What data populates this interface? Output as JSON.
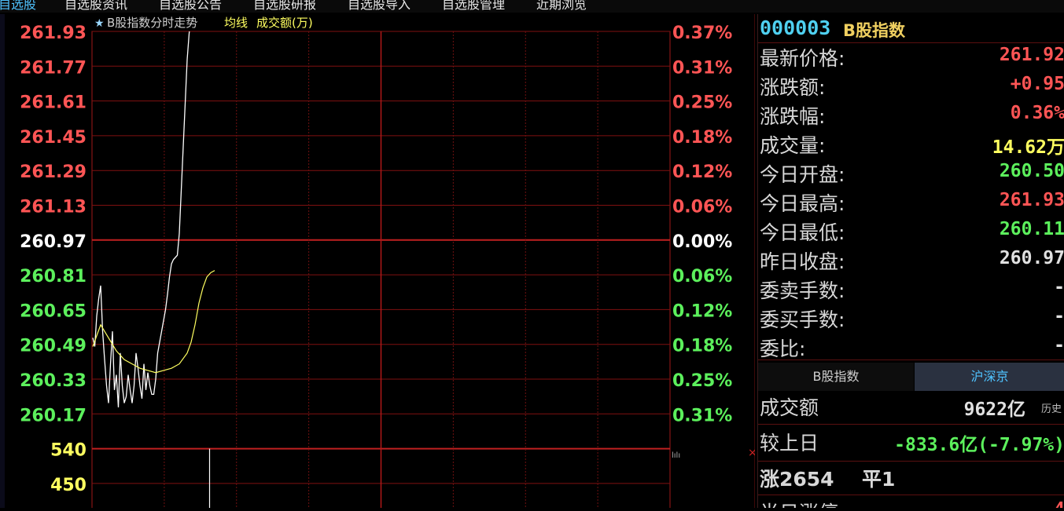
{
  "menu": {
    "tabs": [
      {
        "label": "自选股",
        "active": true
      },
      {
        "label": "自选股资讯",
        "active": false
      },
      {
        "label": "自选股公告",
        "active": false
      },
      {
        "label": "自选股研报",
        "active": false
      },
      {
        "label": "自选股导入",
        "active": false
      },
      {
        "label": "自选股管理",
        "active": false
      },
      {
        "label": "近期浏览",
        "active": false
      }
    ]
  },
  "chart": {
    "header_star": "★",
    "header_title": "B股指数分时走势",
    "header_avg": "均线",
    "header_amount": "成交额(万)",
    "vol_marker": "lılı",
    "close_marker": "×"
  },
  "chart_data": {
    "type": "line",
    "title": "B股指数分时走势",
    "prev_close": 260.97,
    "price_ticks": [
      "261.93",
      "261.77",
      "261.61",
      "261.45",
      "261.29",
      "261.13",
      "260.97",
      "260.81",
      "260.65",
      "260.49",
      "260.33",
      "260.17"
    ],
    "pct_ticks": [
      "0.37%",
      "0.31%",
      "0.25%",
      "0.18%",
      "0.12%",
      "0.06%",
      "0.00%",
      "0.06%",
      "0.12%",
      "0.18%",
      "0.25%",
      "0.31%"
    ],
    "volume_ticks": [
      "540",
      "450"
    ],
    "ylim": [
      260.17,
      261.93
    ],
    "series": [
      {
        "name": "价格",
        "color": "#ffffff",
        "x": [
          0,
          1,
          2,
          3,
          4,
          5,
          6,
          7,
          8,
          9,
          10,
          11,
          12,
          13,
          14,
          15,
          16,
          17,
          18,
          19,
          20,
          21,
          22,
          23,
          24,
          25,
          26,
          27,
          28,
          29,
          30,
          31,
          32,
          33,
          34,
          35,
          36,
          37,
          38,
          39,
          40,
          41,
          42,
          43,
          44,
          45,
          46,
          47,
          48,
          49,
          50,
          51,
          52,
          53,
          54,
          55,
          56,
          57,
          58,
          59,
          60,
          61,
          62
        ],
        "values": [
          260.52,
          260.48,
          260.62,
          260.7,
          260.76,
          260.55,
          260.42,
          260.3,
          260.22,
          260.4,
          260.55,
          260.28,
          260.35,
          260.2,
          260.45,
          260.3,
          260.22,
          260.25,
          260.35,
          260.28,
          260.22,
          260.3,
          260.45,
          260.38,
          260.3,
          260.24,
          260.4,
          260.28,
          260.36,
          260.3,
          260.26,
          260.26,
          260.33,
          260.45,
          260.5,
          260.55,
          260.6,
          260.65,
          260.72,
          260.8,
          260.86,
          260.88,
          260.89,
          260.9,
          261.0,
          261.2,
          261.4,
          261.6,
          261.8,
          261.92,
          262.0,
          262.05,
          262.08,
          262.1,
          262.12,
          262.14,
          262.16,
          262.18,
          262.2,
          262.22,
          262.24,
          262.26,
          262.28
        ]
      },
      {
        "name": "均线",
        "color": "#ffff60",
        "x": [
          0,
          4,
          8,
          12,
          16,
          20,
          24,
          28,
          32,
          36,
          40,
          44,
          48,
          50,
          52,
          54,
          56,
          58,
          60,
          62
        ],
        "values": [
          260.48,
          260.58,
          260.52,
          260.46,
          260.42,
          260.4,
          260.38,
          260.37,
          260.36,
          260.37,
          260.38,
          260.4,
          260.45,
          260.5,
          260.58,
          260.68,
          260.75,
          260.8,
          260.82,
          260.83
        ]
      }
    ],
    "volume": {
      "x": [
        33
      ],
      "values": [
        560
      ]
    }
  },
  "quote": {
    "code": "000003",
    "name": "B股指数",
    "rows": [
      {
        "label": "最新价格:",
        "value": "261.92",
        "color": "red"
      },
      {
        "label": "涨跌额:",
        "value": "+0.95",
        "color": "red"
      },
      {
        "label": "涨跌幅:",
        "value": "0.36%",
        "color": "red"
      },
      {
        "label": "成交量:",
        "value": "14.62万",
        "color": "yellow"
      },
      {
        "label": "今日开盘:",
        "value": "260.50",
        "color": "green"
      },
      {
        "label": "今日最高:",
        "value": "261.93",
        "color": "red"
      },
      {
        "label": "今日最低:",
        "value": "260.11",
        "color": "green"
      },
      {
        "label": "昨日收盘:",
        "value": "260.97",
        "color": "white"
      },
      {
        "label": "委卖手数:",
        "value": "-",
        "color": "white"
      },
      {
        "label": "委买手数:",
        "value": "-",
        "color": "white"
      },
      {
        "label": "委比:",
        "value": "-",
        "color": "white"
      }
    ]
  },
  "market": {
    "tab_b": "B股指数",
    "tab_hsj": "沪深京",
    "amount_label": "成交额",
    "amount_value": "9622亿",
    "history_label": "历史",
    "compare_label": "较上日",
    "compare_value": "-833.6亿(-7.97%)",
    "rise_label": "涨2654",
    "flat_label": "平1",
    "next_label": "半日涨停",
    "next_value": "4"
  }
}
